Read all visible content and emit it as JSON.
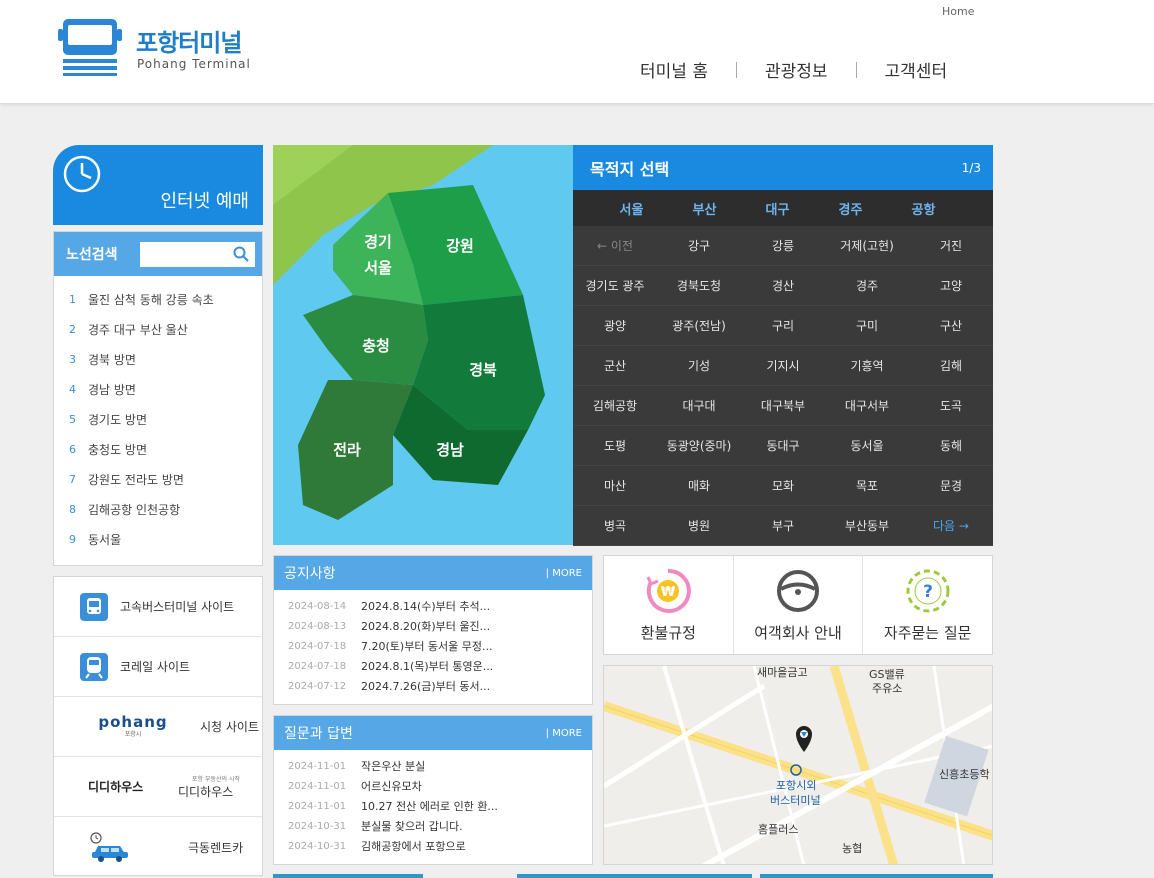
{
  "header": {
    "logo_ko": "포항터미널",
    "logo_en": "Pohang Terminal",
    "home_link": "Home",
    "nav": [
      "터미널 홈",
      "관광정보",
      "고객센터"
    ]
  },
  "reserve": {
    "label": "인터넷 예매"
  },
  "route_search": {
    "title": "노선검색",
    "placeholder": "",
    "items": [
      {
        "num": "1",
        "label": "울진 삼척 동해 강릉 속초"
      },
      {
        "num": "2",
        "label": "경주 대구 부산 울산"
      },
      {
        "num": "3",
        "label": "경북 방면"
      },
      {
        "num": "4",
        "label": "경남 방면"
      },
      {
        "num": "5",
        "label": "경기도 방면"
      },
      {
        "num": "6",
        "label": "충청도 방면"
      },
      {
        "num": "7",
        "label": "강원도 전라도 방면"
      },
      {
        "num": "8",
        "label": "김해공항 인천공항"
      },
      {
        "num": "9",
        "label": "동서울"
      }
    ]
  },
  "links": [
    {
      "label": "고속버스터미널 사이트",
      "icon": "bus-icon"
    },
    {
      "label": "코레일 사이트",
      "icon": "train-icon"
    },
    {
      "label": "시청 사이트",
      "icon": "pohang-logo",
      "logo_text": "pohang",
      "logo_sub": "포항시"
    },
    {
      "label": "디디하우스",
      "icon": "didihouse-logo",
      "logo_text": "디디하우스",
      "logo_sub": "포항 부동산의 시작"
    },
    {
      "label": "극동렌트카",
      "icon": "car-icon"
    }
  ],
  "region_map": {
    "regions": [
      "경기\n서울",
      "강원",
      "충청",
      "경북",
      "전라",
      "경남"
    ]
  },
  "destination": {
    "title": "목적지 선택",
    "page": "1/3",
    "tabs": [
      "서울",
      "부산",
      "대구",
      "경주",
      "공항"
    ],
    "cells": [
      "← 이전",
      "강구",
      "강릉",
      "거제(고현)",
      "거진",
      "경기도 광주",
      "경북도청",
      "경산",
      "경주",
      "고양",
      "광양",
      "광주(전남)",
      "구리",
      "구미",
      "구산",
      "군산",
      "기성",
      "기지시",
      "기흥역",
      "김해",
      "김해공항",
      "대구대",
      "대구북부",
      "대구서부",
      "도곡",
      "도평",
      "동광양(중마)",
      "동대구",
      "동서울",
      "동해",
      "마산",
      "매화",
      "모화",
      "목포",
      "문경",
      "병곡",
      "병원",
      "부구",
      "부산동부",
      "다음 →"
    ]
  },
  "notice": {
    "title": "공지사항",
    "more": "| MORE",
    "items": [
      {
        "date": "2024-08-14",
        "text": "2024.8.14(수)부터 추석..."
      },
      {
        "date": "2024-08-13",
        "text": "2024.8.20(화)부터 울진..."
      },
      {
        "date": "2024-07-18",
        "text": "7.20(토)부터 동서울 무정..."
      },
      {
        "date": "2024-07-18",
        "text": "2024.8.1(목)부터 통영운..."
      },
      {
        "date": "2024-07-12",
        "text": "2024.7.26(금)부터 동서..."
      }
    ]
  },
  "qna": {
    "title": "질문과 답변",
    "more": "| MORE",
    "items": [
      {
        "date": "2024-11-01",
        "text": "작은우산 분실"
      },
      {
        "date": "2024-11-01",
        "text": "어르신유모차"
      },
      {
        "date": "2024-11-01",
        "text": "10.27 전산 에러로 인한 환..."
      },
      {
        "date": "2024-10-31",
        "text": "분실물 찾으러 갑니다."
      },
      {
        "date": "2024-10-31",
        "text": "김해공항에서 포항으로"
      }
    ]
  },
  "quick": [
    {
      "label": "환불규정",
      "icon": "refund-icon",
      "symbol": "₩"
    },
    {
      "label": "여객회사 안내",
      "icon": "steering-wheel-icon"
    },
    {
      "label": "자주묻는 질문",
      "icon": "question-icon",
      "symbol": "?"
    }
  ],
  "minimap": {
    "labels": {
      "bank": "새마을금고",
      "gas1": "GS밸류",
      "gas2": "주유소",
      "school": "신흥초등학",
      "terminal1": "포항시외",
      "terminal2": "버스터미널",
      "store": "홈플러스",
      "nh": "농협"
    }
  }
}
